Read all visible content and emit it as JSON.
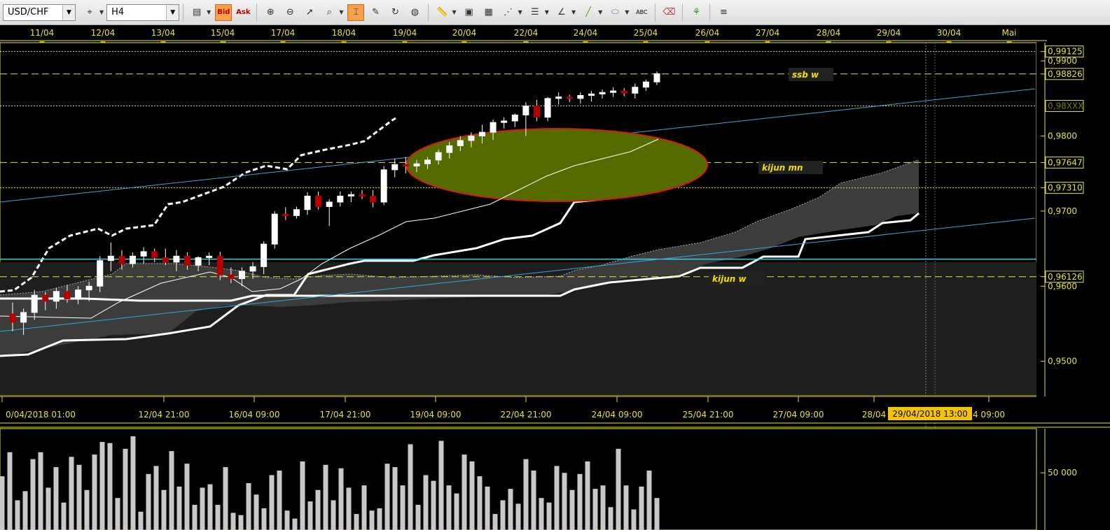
{
  "toolbar": {
    "symbol": "USD/CHF",
    "timeframe": "H4",
    "bid_label": "Bid",
    "ask_label": "Ask",
    "abc_label": "ABC",
    "icons": [
      "crosshair-icon",
      "bar-chart-icon",
      "zoom-icon",
      "globe-icon",
      "ruler-icon",
      "image-icon",
      "line-icon",
      "fibonacci-icon",
      "brush-icon",
      "ellipse-icon",
      "eraser-icon",
      "tree-icon"
    ]
  },
  "date_labels": [
    "11/04",
    "12/04",
    "13/04",
    "15/04",
    "17/04",
    "18/04",
    "19/04",
    "20/04",
    "22/04",
    "24/04",
    "25/04",
    "26/04",
    "27/04",
    "28/04",
    "29/04",
    "30/04",
    "Mai"
  ],
  "time_labels": [
    "0/04/2018 01:00",
    "12/04 21:00",
    "16/04 09:00",
    "17/04 21:00",
    "19/04 09:00",
    "22/04 21:00",
    "24/04 09:00",
    "25/04 21:00",
    "27/04 09:00",
    "28/04",
    "4 09:00"
  ],
  "cursor_time": "29/04/2018 13:00",
  "price_labels": [
    "0,99125",
    "0,9900",
    "0,98826",
    "0,9800",
    "0,97647",
    "0,97310",
    "0,9700",
    "0,96126",
    "0,9600",
    "0,9500"
  ],
  "price_hidden": "0,98XXX",
  "annotations": {
    "ssb_w": "ssb w",
    "kijun_mn": "kijun mn",
    "kijun_w": "kijun w"
  },
  "volume_label": "50 000",
  "colors": {
    "level_line": "#e6e23a",
    "horizontal_cyan": "#36d0e6",
    "trendline": "#3aa6d8",
    "ellipse_fill": "#556b00",
    "ellipse_stroke": "#d11a1a",
    "cloud_fill": "#3c3c3c",
    "bear_candle": "#b30000"
  },
  "chart_data": {
    "type": "candlestick",
    "instrument": "USD/CHF",
    "timeframe": "H4",
    "ylim": [
      0.9455,
      0.9915
    ],
    "candles_ohlc": [
      [
        0.9563,
        0.9578,
        0.954,
        0.9552
      ],
      [
        0.9552,
        0.957,
        0.9535,
        0.9565
      ],
      [
        0.9565,
        0.9595,
        0.9555,
        0.9588
      ],
      [
        0.9588,
        0.9592,
        0.9568,
        0.958
      ],
      [
        0.958,
        0.9598,
        0.957,
        0.9593
      ],
      [
        0.9593,
        0.9602,
        0.9578,
        0.9583
      ],
      [
        0.9583,
        0.96,
        0.9576,
        0.9595
      ],
      [
        0.9595,
        0.9606,
        0.958,
        0.96
      ],
      [
        0.96,
        0.964,
        0.9592,
        0.9634
      ],
      [
        0.9634,
        0.9658,
        0.962,
        0.964
      ],
      [
        0.964,
        0.9648,
        0.9622,
        0.963
      ],
      [
        0.963,
        0.9645,
        0.9625,
        0.964
      ],
      [
        0.964,
        0.9652,
        0.963,
        0.9646
      ],
      [
        0.9646,
        0.965,
        0.9632,
        0.9638
      ],
      [
        0.9638,
        0.965,
        0.9628,
        0.9632
      ],
      [
        0.9632,
        0.9648,
        0.962,
        0.964
      ],
      [
        0.964,
        0.9645,
        0.9622,
        0.9628
      ],
      [
        0.9628,
        0.964,
        0.962,
        0.9638
      ],
      [
        0.9638,
        0.9645,
        0.9628,
        0.964
      ],
      [
        0.964,
        0.9646,
        0.9608,
        0.9615
      ],
      [
        0.9615,
        0.9625,
        0.9604,
        0.961
      ],
      [
        0.961,
        0.9625,
        0.96,
        0.962
      ],
      [
        0.962,
        0.9632,
        0.961,
        0.9626
      ],
      [
        0.9626,
        0.966,
        0.9616,
        0.9656
      ],
      [
        0.9656,
        0.97,
        0.965,
        0.9696
      ],
      [
        0.9696,
        0.9705,
        0.9688,
        0.9694
      ],
      [
        0.9694,
        0.9706,
        0.969,
        0.9702
      ],
      [
        0.9702,
        0.9725,
        0.9695,
        0.972
      ],
      [
        0.972,
        0.9726,
        0.9702,
        0.9706
      ],
      [
        0.9706,
        0.9716,
        0.968,
        0.9712
      ],
      [
        0.9712,
        0.9726,
        0.9706,
        0.972
      ],
      [
        0.972,
        0.9726,
        0.9712,
        0.9722
      ],
      [
        0.9722,
        0.9728,
        0.9716,
        0.972
      ],
      [
        0.972,
        0.9728,
        0.9705,
        0.9712
      ],
      [
        0.9712,
        0.976,
        0.9708,
        0.9755
      ],
      [
        0.9755,
        0.977,
        0.9745,
        0.9762
      ],
      [
        0.9762,
        0.9772,
        0.975,
        0.976
      ],
      [
        0.976,
        0.9768,
        0.9752,
        0.9763
      ],
      [
        0.9763,
        0.9772,
        0.9756,
        0.9768
      ],
      [
        0.9768,
        0.9782,
        0.9762,
        0.9778
      ],
      [
        0.9778,
        0.9792,
        0.977,
        0.9787
      ],
      [
        0.9787,
        0.98,
        0.978,
        0.9794
      ],
      [
        0.9794,
        0.9805,
        0.9785,
        0.98
      ],
      [
        0.98,
        0.9815,
        0.979,
        0.9805
      ],
      [
        0.9805,
        0.9822,
        0.9795,
        0.9818
      ],
      [
        0.9818,
        0.9825,
        0.981,
        0.982
      ],
      [
        0.982,
        0.983,
        0.9812,
        0.9828
      ],
      [
        0.9828,
        0.9845,
        0.98,
        0.984
      ],
      [
        0.984,
        0.9848,
        0.982,
        0.9825
      ],
      [
        0.9825,
        0.9852,
        0.982,
        0.985
      ],
      [
        0.985,
        0.9858,
        0.9842,
        0.9852
      ],
      [
        0.9852,
        0.9855,
        0.9845,
        0.985
      ],
      [
        0.985,
        0.9858,
        0.9843,
        0.9854
      ],
      [
        0.9854,
        0.986,
        0.9846,
        0.9856
      ],
      [
        0.9856,
        0.9862,
        0.985,
        0.9858
      ],
      [
        0.9858,
        0.9865,
        0.9852,
        0.986
      ],
      [
        0.986,
        0.9864,
        0.9853,
        0.9857
      ],
      [
        0.9857,
        0.987,
        0.985,
        0.9865
      ],
      [
        0.9865,
        0.9875,
        0.986,
        0.9872
      ],
      [
        0.9872,
        0.9886,
        0.9868,
        0.9883
      ]
    ],
    "horizontal_levels": [
      0.99125,
      0.98826,
      0.984,
      0.97647,
      0.9731,
      0.96126
    ],
    "volumes": [
      47,
      68,
      26,
      34,
      62,
      68,
      37,
      55,
      24,
      64,
      57,
      35,
      66,
      77,
      76,
      28,
      71,
      82,
      16,
      49,
      56,
      35,
      69,
      38,
      58,
      22,
      37,
      40,
      22,
      55,
      15,
      13,
      41,
      31,
      19,
      48,
      52,
      17,
      10,
      60,
      25,
      35,
      57,
      26,
      54,
      37,
      14,
      39,
      17,
      19,
      58,
      55,
      39,
      75,
      22,
      48,
      43,
      78,
      39,
      32,
      66,
      60,
      47,
      38,
      14,
      26,
      36,
      23,
      62,
      52,
      28,
      24,
      56,
      50,
      35,
      49,
      60,
      36,
      39,
      20,
      71,
      39,
      18,
      38,
      52,
      28
    ]
  }
}
